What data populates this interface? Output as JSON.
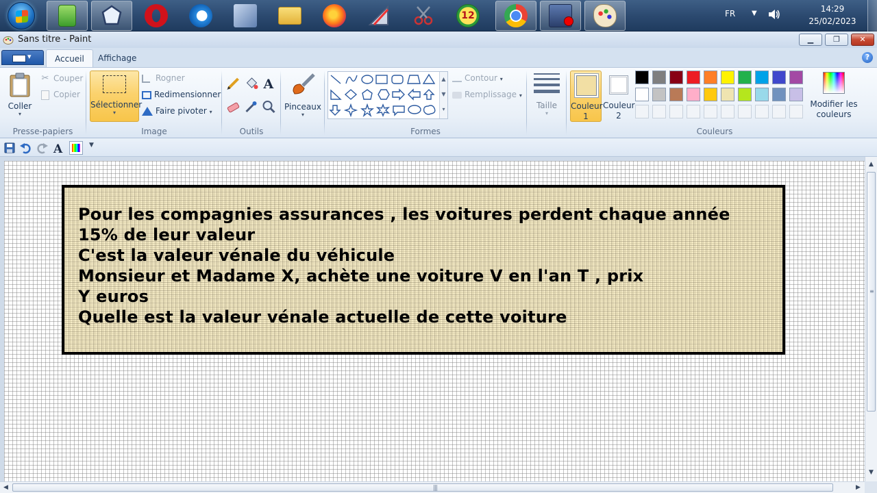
{
  "taskbar": {
    "apps": [
      {
        "name": "calculator-icon",
        "pinned": true
      },
      {
        "name": "shape-tool-icon",
        "pinned": true
      },
      {
        "name": "opera-icon",
        "pinned": false
      },
      {
        "name": "internet-explorer-icon",
        "pinned": false
      },
      {
        "name": "tools-icon",
        "pinned": false
      },
      {
        "name": "folder-icon",
        "pinned": false
      },
      {
        "name": "firefox-icon",
        "pinned": false
      },
      {
        "name": "geometry-icon",
        "pinned": false
      },
      {
        "name": "scissors-icon",
        "pinned": false
      },
      {
        "name": "twelve-badge-icon",
        "pinned": false
      },
      {
        "name": "chrome-icon",
        "pinned": true
      },
      {
        "name": "recorder-icon",
        "pinned": true
      },
      {
        "name": "paint-icon",
        "pinned": true
      }
    ],
    "badge_number": "12",
    "language": "FR",
    "time": "14:29",
    "date": "25/02/2023"
  },
  "window": {
    "title": "Sans titre - Paint"
  },
  "ribbon": {
    "tabs": [
      "Accueil",
      "Affichage"
    ],
    "clipboard": {
      "paste": "Coller",
      "cut": "Couper",
      "copy": "Copier",
      "label": "Presse-papiers"
    },
    "image": {
      "select": "Sélectionner",
      "crop": "Rogner",
      "resize": "Redimensionner",
      "rotate": "Faire pivoter",
      "label": "Image"
    },
    "tools": {
      "label": "Outils"
    },
    "brushes": {
      "label": "Pinceaux"
    },
    "shapes": {
      "outline": "Contour",
      "fill": "Remplissage",
      "label": "Formes"
    },
    "size": {
      "label": "Taille"
    },
    "colors": {
      "color1": "Couleur",
      "color1_num": "1",
      "color2": "Couleur",
      "color2_num": "2",
      "edit_line1": "Modifier les",
      "edit_line2": "couleurs",
      "label": "Couleurs",
      "color1_value": "#f2dfa4",
      "color2_value": "#ffffff",
      "palette_row1": [
        "#000000",
        "#7f7f7f",
        "#880015",
        "#ed1c24",
        "#ff7f27",
        "#fff200",
        "#22b14c",
        "#00a2e8",
        "#3f48cc",
        "#a349a4"
      ],
      "palette_row2": [
        "#ffffff",
        "#c3c3c3",
        "#b97a57",
        "#ffaec9",
        "#ffc90e",
        "#efe4b0",
        "#b5e61d",
        "#99d9ea",
        "#7092be",
        "#c8bfe7"
      ]
    }
  },
  "canvas": {
    "box_color": "#efdca0",
    "lines": [
      "Pour les compagnies assurances  , les voitures perdent chaque année",
      "15% de leur valeur",
      "C'est la valeur vénale du véhicule",
      "Monsieur et Madame X, achète une voiture V en l'an T , prix",
      "Y euros",
      "Quelle est la valeur vénale actuelle de cette voiture"
    ]
  }
}
